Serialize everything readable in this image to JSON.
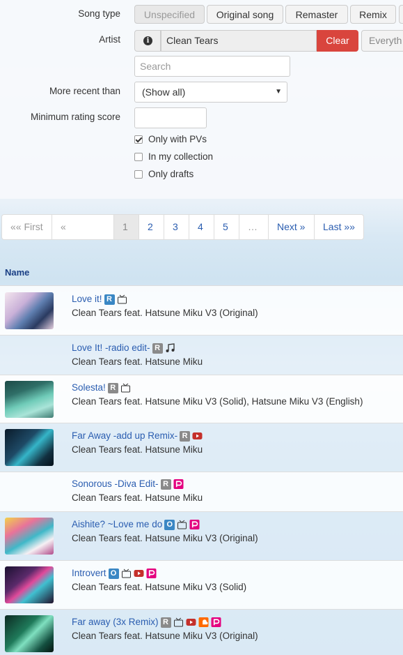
{
  "filters": {
    "song_type_label": "Song type",
    "song_types": [
      "Unspecified",
      "Original song",
      "Remaster",
      "Remix"
    ],
    "artist_label": "Artist",
    "artist_value": "Clean Tears",
    "clear_label": "Clear",
    "everything_label": "Everyth",
    "search_placeholder": "Search",
    "more_recent_label": "More recent than",
    "more_recent_value": "(Show all)",
    "min_rating_label": "Minimum rating score",
    "only_pvs_label": "Only with PVs",
    "in_collection_label": "In my collection",
    "only_drafts_label": "Only drafts"
  },
  "pager": [
    "«« First",
    "« Previous",
    "1",
    "2",
    "3",
    "4",
    "5",
    "…",
    "Next »",
    "Last »»"
  ],
  "table": {
    "name_header": "Name",
    "rows": [
      {
        "title": "Love it!",
        "artist": "Clean Tears feat. Hatsune Miku V3 (Original)"
      },
      {
        "title": "Love It! -radio edit-",
        "artist": "Clean Tears feat. Hatsune Miku"
      },
      {
        "title": "Solesta!",
        "artist": "Clean Tears feat. Hatsune Miku V3 (Solid), Hatsune Miku V3 (English)"
      },
      {
        "title": "Far Away -add up Remix-",
        "artist": "Clean Tears feat. Hatsune Miku"
      },
      {
        "title": "Sonorous -Diva Edit-",
        "artist": "Clean Tears feat. Hatsune Miku"
      },
      {
        "title": "Aishite? ~Love me do",
        "artist": "Clean Tears feat. Hatsune Miku V3 (Original)"
      },
      {
        "title": "Introvert",
        "artist": "Clean Tears feat. Hatsune Miku V3 (Solid)"
      },
      {
        "title": "Far away (3x Remix)",
        "artist": "Clean Tears feat. Hatsune Miku V3 (Original)"
      }
    ]
  },
  "icons": [
    "info-icon",
    "dropdown-arrow-icon",
    "niconico-icon",
    "music-note-icon",
    "youtube-icon",
    "piapro-icon",
    "soundcloud-icon"
  ],
  "colors": {
    "clear_button": "#d9453d",
    "link": "#2a5db0",
    "youtube": "#c4302b",
    "piapro": "#e4007f",
    "soundcloud": "#ff6a00",
    "original_badge": "#3a87c4",
    "remix_badge": "#8a8a8a"
  }
}
